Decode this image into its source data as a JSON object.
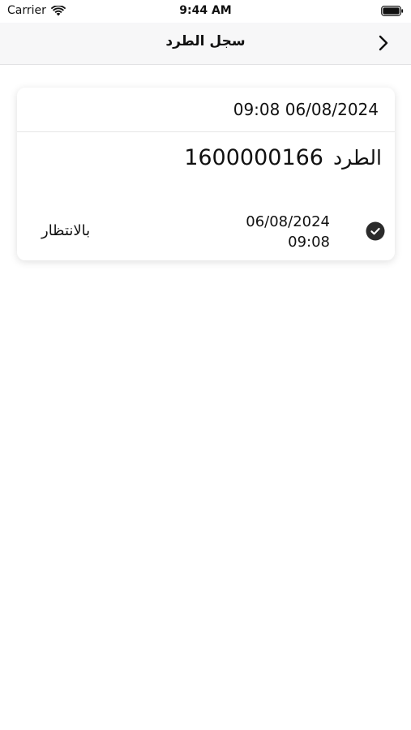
{
  "status_bar": {
    "carrier": "Carrier",
    "time": "9:44 AM"
  },
  "nav": {
    "title": "سجل الطرد",
    "back_icon": "chevron-right-icon"
  },
  "card": {
    "header_datetime": "09:08 06/08/2024",
    "parcel_label": "الطرد",
    "parcel_number": "1600000166",
    "history": {
      "date": "06/08/2024",
      "time": "09:08",
      "status": "بالانتظار",
      "icon": "check-circle-icon",
      "icon_color": "#2b2b2b"
    }
  }
}
